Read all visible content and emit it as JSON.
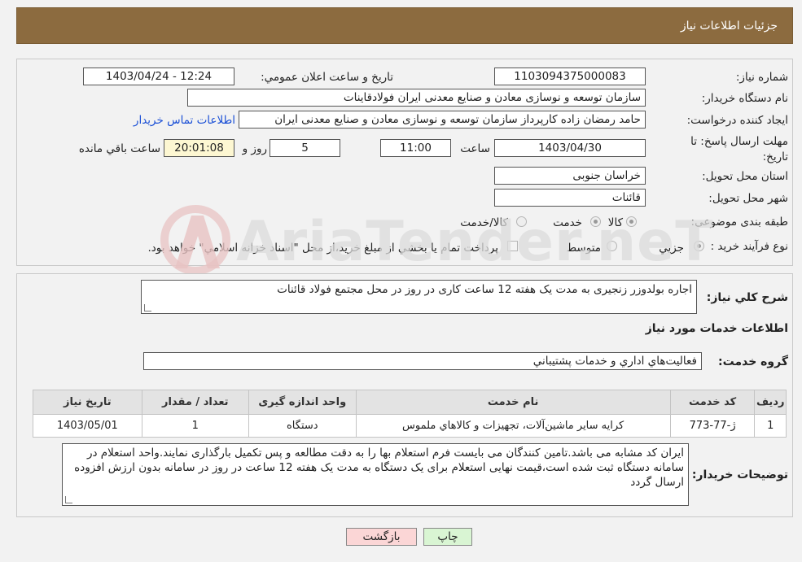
{
  "header": {
    "title": "جزئيات اطلاعات نياز"
  },
  "form": {
    "need_number_label": "شماره نياز:",
    "need_number": "1103094375000083",
    "announce_label": "تاريخ و ساعت اعلان عمومي:",
    "announce_value": "1403/04/24 - 12:24",
    "buyer_org_label": "نام دستگاه خريدار:",
    "buyer_org": "سازمان توسعه و نوسازی معادن و صنایع معدنی ایران فولادقاینات",
    "creator_label": "ايجاد کننده درخواست:",
    "creator": "حامد  رمضان زاده  کارپرداز  سازمان توسعه و نوسازی معادن و صنایع معدنی ایران",
    "contact_link": "اطلاعات تماس خريدار",
    "deadline_label": "مهلت ارسال پاسخ: تا تاريخ:",
    "deadline_date": "1403/04/30",
    "time_label": "ساعت",
    "deadline_time": "11:00",
    "days_value": "5",
    "days_label": "روز و",
    "remaining_time": "20:01:08",
    "remaining_label": "ساعت باقي مانده",
    "province_label": "استان محل تحويل:",
    "province": "خراسان جنوبی",
    "city_label": "شهر محل تحويل:",
    "city": "قائنات",
    "category_label": "طبقه بندی موضوعی:",
    "category_options": [
      "کالا",
      "خدمت",
      "کالا/خدمت"
    ],
    "process_label": "نوع فرآيند خريد :",
    "process_options": [
      "جزیي",
      "متوسط"
    ],
    "payment_note": "پرداخت تمام يا بخشي از مبلغ خريد،از محل \"اسناد خزانه اسلامي\" خواهد بود."
  },
  "description": {
    "label": "شرح کلي نياز:",
    "text": "اجاره بولدوزر زنجیری به مدت یک هفته 12 ساعت کاری در روز در محل مجتمع فولاد قائنات"
  },
  "services": {
    "section_title": "اطلاعات خدمات مورد نياز",
    "group_label": "گروه خدمت:",
    "group_value": "فعاليت‌هاي اداري و خدمات پشتيباني",
    "columns": [
      "رديف",
      "کد خدمت",
      "نام خدمت",
      "واحد اندازه گيری",
      "تعداد / مقدار",
      "تاريخ نياز"
    ],
    "rows": [
      [
        "1",
        "ژ-77-773",
        "کرايه ساير ماشين‌آلات، تجهيزات و کالاهاي ملموس",
        "دستگاه",
        "1",
        "1403/05/01"
      ]
    ]
  },
  "notes": {
    "label": "توضيحات خريدار:",
    "text": "ایران کد مشابه می باشد.تامین کنندگان می بایست فرم استعلام بها را به دقت مطالعه و پس تکمیل بارگذاری نمایند.واحد استعلام در سامانه دستگاه ثبت شده است،قیمت نهایی استعلام برای یک دستگاه به مدت یک هفته 12 ساعت در روز در سامانه بدون ارزش افزوده ارسال گردد"
  },
  "buttons": {
    "print": "چاپ",
    "back": "بازگشت"
  },
  "watermark": {
    "text": "AriaTender.neT"
  },
  "colors": {
    "header_bg": "#8c6b3f",
    "back_button_bg": "#fbd6d6",
    "print_button_bg": "#d9f5d3",
    "link": "#1a4fd6"
  }
}
